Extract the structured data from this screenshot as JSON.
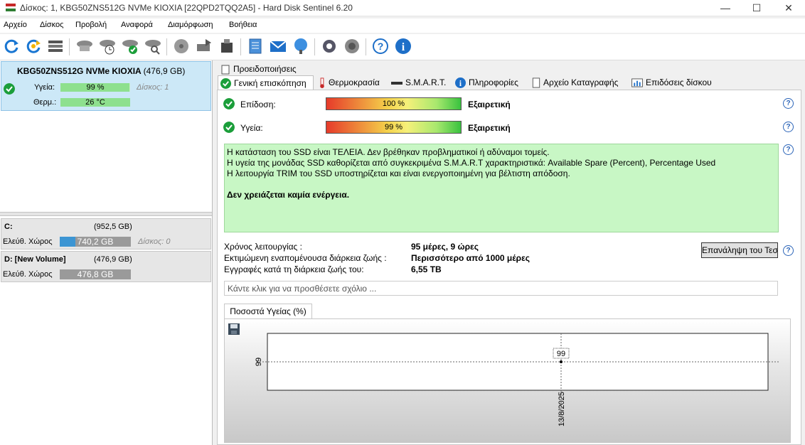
{
  "window": {
    "title": "Δίσκος: 1, KBG50ZNS512G NVMe KIOXIA [22QPD2TQQ2A5]  -  Hard Disk Sentinel 6.20",
    "minimize": "—",
    "maximize": "☐",
    "close": "✕"
  },
  "menu": [
    "Αρχείο",
    "Δίσκος",
    "Προβολή",
    "Αναφορά",
    "Διαμόρφωση",
    "Βοήθεια"
  ],
  "toolbar_icons": [
    "refresh-icon",
    "refresh-all-icon",
    "disk-list-icon",
    "disk-test-icon",
    "disk-schedule-icon",
    "disk-ok-icon",
    "disk-search-icon",
    "surface-test-icon",
    "disk-export-icon",
    "disk-usb-icon",
    "notepad-icon",
    "email-icon",
    "network-icon",
    "settings-icon",
    "speaker-icon",
    "help-icon",
    "info-icon"
  ],
  "disk": {
    "name": "KBG50ZNS512G NVMe KIOXIA",
    "size": "(476,9 GB)",
    "health_label": "Υγεία:",
    "health_value": "99 %",
    "health_percent": 99,
    "disk_index": "Δίσκος: 1",
    "temp_label": "Θερμ.:",
    "temp_value": "26 °C"
  },
  "volumes": [
    {
      "name": "C:",
      "size": "(952,5 GB)",
      "free_label": "Ελεύθ. Χώρος",
      "free_value": "740,2 GB",
      "free_fraction": 0.22,
      "bar_color": "#3c95d3",
      "disk_index": "Δίσκος: 0"
    },
    {
      "name": "D: [New Volume]",
      "size": "(476,9 GB)",
      "free_label": "Ελεύθ. Χώρος",
      "free_value": "476,8 GB",
      "free_fraction": 0.0,
      "bar_color": "#9a9a9a",
      "disk_index": ""
    }
  ],
  "tabs": {
    "top": "Προειδοποιήσεις",
    "row": [
      "Γενική επισκόπηση",
      "Θερμοκρασία",
      "S.M.A.R.T.",
      "Πληροφορίες",
      "Αρχείο Καταγραφής",
      "Επιδόσεις δίσκου"
    ]
  },
  "overview": {
    "performance_label": "Επίδοση:",
    "performance_value": "100 %",
    "performance_percent": 100,
    "performance_rating": "Εξαιρετική",
    "health_label": "Υγεία:",
    "health_value": "99 %",
    "health_percent": 99,
    "health_rating": "Εξαιρετική",
    "status_lines": [
      "Η κατάσταση του SSD είναι ΤΕΛΕΙΑ. Δεν βρέθηκαν προβληματικοί ή αδύναμοι τομείς.",
      "Η υγεία  της μονάδας SSD καθορίζεται από συγκεκριμένα S.M.A.R.T χαρακτηριστικά: Available Spare (Percent), Percentage Used",
      "Η λειτουργία TRIM του SSD υποστηρίζεται και είναι ενεργοποιημένη για βέλτιστη απόδοση."
    ],
    "status_action": "Δεν χρειάζεται καμία ενέργεια.",
    "uptime_label": "Χρόνος λειτουργίας :",
    "uptime_value": "95 μέρες, 9 ώρες",
    "lifetime_label": "Εκτιμώμενη εναπομένουσα διάρκεια ζωής :",
    "lifetime_value": "Περισσότερο από 1000 μέρες",
    "writes_label": "Εγγραφές κατά τη διάρκεια ζωής του:",
    "writes_value": "6,55 TB",
    "retest_button": "Επανάληψη του Τεστ",
    "comment_placeholder": "Κάντε κλικ για να προσθέσετε σχόλιο ..."
  },
  "chart_tab": "Ποσοστά Υγείας (%)",
  "chart_data": {
    "type": "line",
    "x": [
      "13/8/2025"
    ],
    "series": [
      {
        "values": [
          99
        ]
      }
    ],
    "data_labels": [
      "99"
    ],
    "y_ticks": [
      "99"
    ],
    "x_ticks": [
      "13/8/2025"
    ],
    "grid": true
  },
  "colors": {
    "selected_bg": "#cce8f7",
    "status_bg": "#c8f7c5",
    "ok_green": "#1b9e3a",
    "help_blue": "#2b64b8"
  }
}
